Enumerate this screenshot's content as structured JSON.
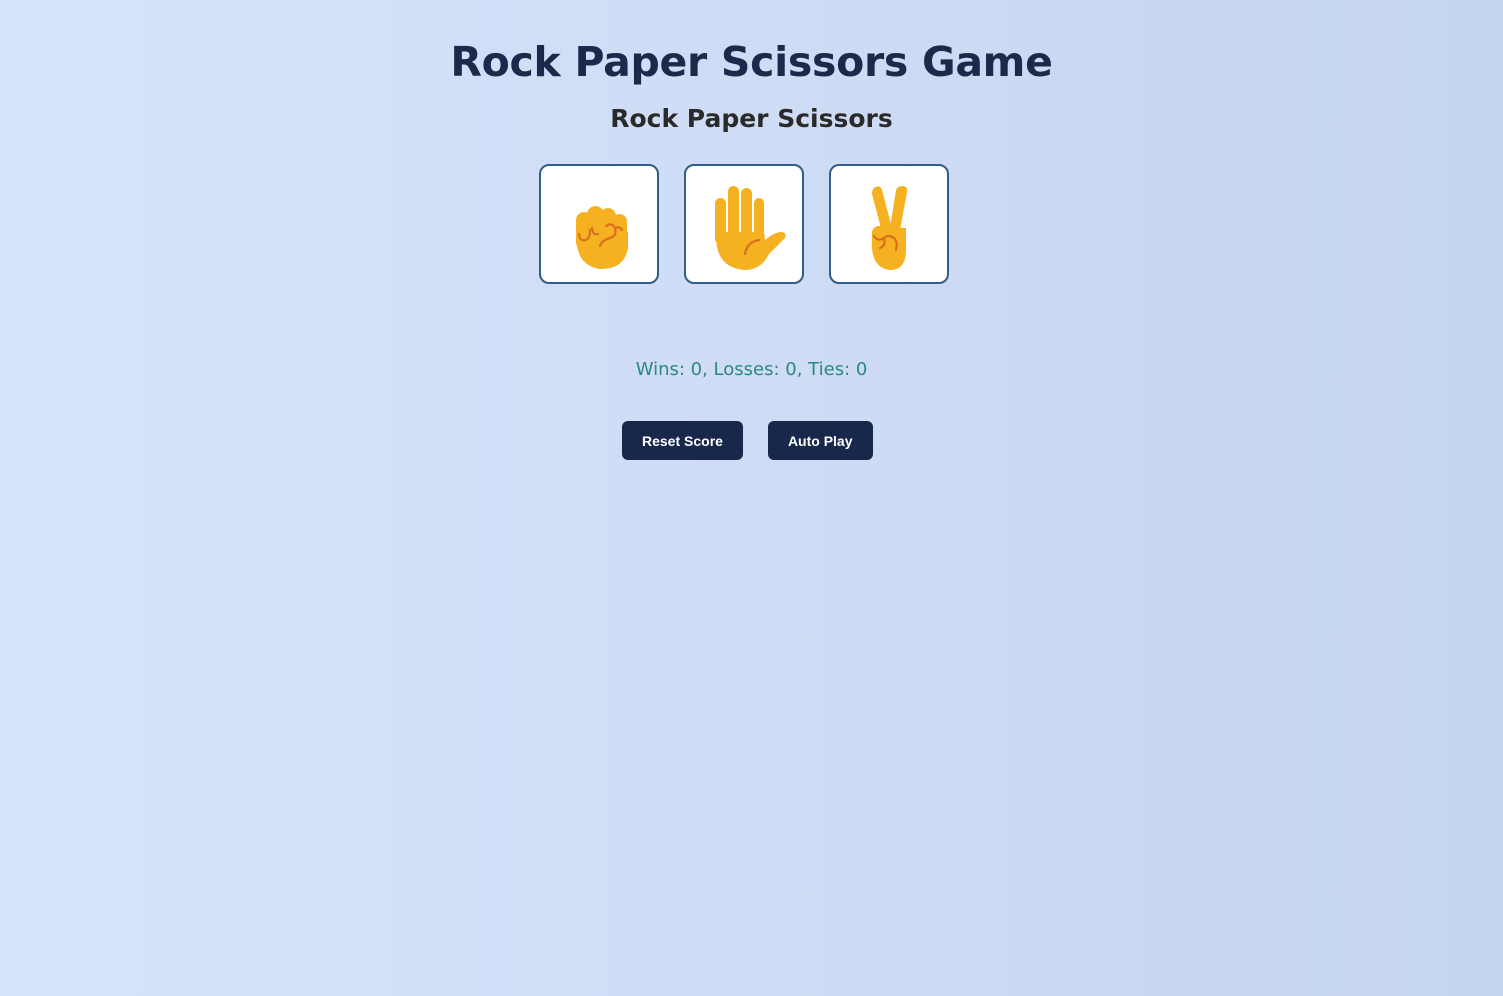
{
  "title": "Rock Paper Scissors Game",
  "subtitle": "Rock Paper Scissors",
  "moves": [
    {
      "name": "rock",
      "icon": "raised-fist-icon"
    },
    {
      "name": "paper",
      "icon": "raised-hand-icon"
    },
    {
      "name": "scissors",
      "icon": "victory-hand-icon"
    }
  ],
  "score": {
    "text": "Wins: 0, Losses: 0, Ties: 0",
    "wins": 0,
    "losses": 0,
    "ties": 0
  },
  "buttons": {
    "reset_label": "Reset Score",
    "autoplay_label": "Auto Play"
  },
  "colors": {
    "title": "#1b2a4a",
    "score_text": "#2a8a7e",
    "button_bg": "#17284a",
    "move_border": "#2f5f8a",
    "emoji_fill": "#f5b120",
    "emoji_line": "#d9701e"
  }
}
